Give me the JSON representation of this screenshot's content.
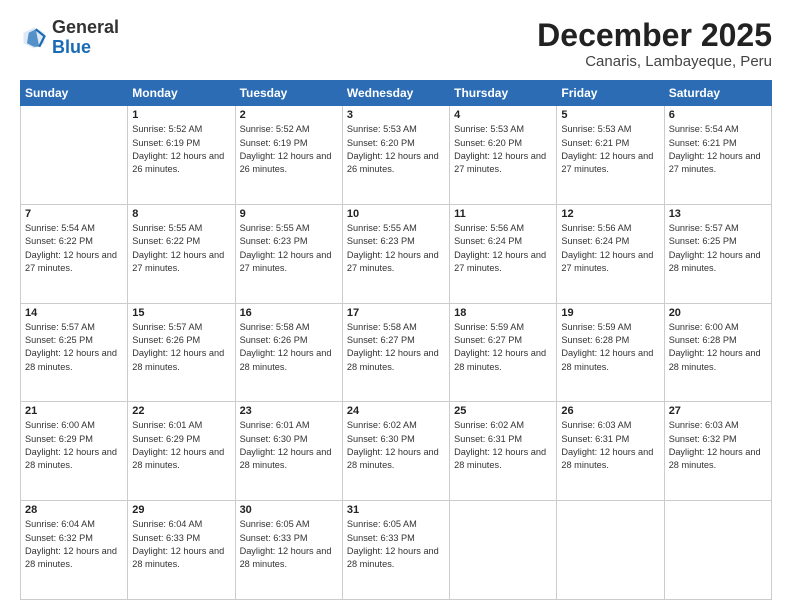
{
  "header": {
    "logo_general": "General",
    "logo_blue": "Blue",
    "month": "December 2025",
    "location": "Canaris, Lambayeque, Peru"
  },
  "days_of_week": [
    "Sunday",
    "Monday",
    "Tuesday",
    "Wednesday",
    "Thursday",
    "Friday",
    "Saturday"
  ],
  "weeks": [
    [
      {
        "day": "",
        "info": ""
      },
      {
        "day": "1",
        "info": "Sunrise: 5:52 AM\nSunset: 6:19 PM\nDaylight: 12 hours\nand 26 minutes."
      },
      {
        "day": "2",
        "info": "Sunrise: 5:52 AM\nSunset: 6:19 PM\nDaylight: 12 hours\nand 26 minutes."
      },
      {
        "day": "3",
        "info": "Sunrise: 5:53 AM\nSunset: 6:20 PM\nDaylight: 12 hours\nand 26 minutes."
      },
      {
        "day": "4",
        "info": "Sunrise: 5:53 AM\nSunset: 6:20 PM\nDaylight: 12 hours\nand 27 minutes."
      },
      {
        "day": "5",
        "info": "Sunrise: 5:53 AM\nSunset: 6:21 PM\nDaylight: 12 hours\nand 27 minutes."
      },
      {
        "day": "6",
        "info": "Sunrise: 5:54 AM\nSunset: 6:21 PM\nDaylight: 12 hours\nand 27 minutes."
      }
    ],
    [
      {
        "day": "7",
        "info": "Sunrise: 5:54 AM\nSunset: 6:22 PM\nDaylight: 12 hours\nand 27 minutes."
      },
      {
        "day": "8",
        "info": "Sunrise: 5:55 AM\nSunset: 6:22 PM\nDaylight: 12 hours\nand 27 minutes."
      },
      {
        "day": "9",
        "info": "Sunrise: 5:55 AM\nSunset: 6:23 PM\nDaylight: 12 hours\nand 27 minutes."
      },
      {
        "day": "10",
        "info": "Sunrise: 5:55 AM\nSunset: 6:23 PM\nDaylight: 12 hours\nand 27 minutes."
      },
      {
        "day": "11",
        "info": "Sunrise: 5:56 AM\nSunset: 6:24 PM\nDaylight: 12 hours\nand 27 minutes."
      },
      {
        "day": "12",
        "info": "Sunrise: 5:56 AM\nSunset: 6:24 PM\nDaylight: 12 hours\nand 27 minutes."
      },
      {
        "day": "13",
        "info": "Sunrise: 5:57 AM\nSunset: 6:25 PM\nDaylight: 12 hours\nand 28 minutes."
      }
    ],
    [
      {
        "day": "14",
        "info": "Sunrise: 5:57 AM\nSunset: 6:25 PM\nDaylight: 12 hours\nand 28 minutes."
      },
      {
        "day": "15",
        "info": "Sunrise: 5:57 AM\nSunset: 6:26 PM\nDaylight: 12 hours\nand 28 minutes."
      },
      {
        "day": "16",
        "info": "Sunrise: 5:58 AM\nSunset: 6:26 PM\nDaylight: 12 hours\nand 28 minutes."
      },
      {
        "day": "17",
        "info": "Sunrise: 5:58 AM\nSunset: 6:27 PM\nDaylight: 12 hours\nand 28 minutes."
      },
      {
        "day": "18",
        "info": "Sunrise: 5:59 AM\nSunset: 6:27 PM\nDaylight: 12 hours\nand 28 minutes."
      },
      {
        "day": "19",
        "info": "Sunrise: 5:59 AM\nSunset: 6:28 PM\nDaylight: 12 hours\nand 28 minutes."
      },
      {
        "day": "20",
        "info": "Sunrise: 6:00 AM\nSunset: 6:28 PM\nDaylight: 12 hours\nand 28 minutes."
      }
    ],
    [
      {
        "day": "21",
        "info": "Sunrise: 6:00 AM\nSunset: 6:29 PM\nDaylight: 12 hours\nand 28 minutes."
      },
      {
        "day": "22",
        "info": "Sunrise: 6:01 AM\nSunset: 6:29 PM\nDaylight: 12 hours\nand 28 minutes."
      },
      {
        "day": "23",
        "info": "Sunrise: 6:01 AM\nSunset: 6:30 PM\nDaylight: 12 hours\nand 28 minutes."
      },
      {
        "day": "24",
        "info": "Sunrise: 6:02 AM\nSunset: 6:30 PM\nDaylight: 12 hours\nand 28 minutes."
      },
      {
        "day": "25",
        "info": "Sunrise: 6:02 AM\nSunset: 6:31 PM\nDaylight: 12 hours\nand 28 minutes."
      },
      {
        "day": "26",
        "info": "Sunrise: 6:03 AM\nSunset: 6:31 PM\nDaylight: 12 hours\nand 28 minutes."
      },
      {
        "day": "27",
        "info": "Sunrise: 6:03 AM\nSunset: 6:32 PM\nDaylight: 12 hours\nand 28 minutes."
      }
    ],
    [
      {
        "day": "28",
        "info": "Sunrise: 6:04 AM\nSunset: 6:32 PM\nDaylight: 12 hours\nand 28 minutes."
      },
      {
        "day": "29",
        "info": "Sunrise: 6:04 AM\nSunset: 6:33 PM\nDaylight: 12 hours\nand 28 minutes."
      },
      {
        "day": "30",
        "info": "Sunrise: 6:05 AM\nSunset: 6:33 PM\nDaylight: 12 hours\nand 28 minutes."
      },
      {
        "day": "31",
        "info": "Sunrise: 6:05 AM\nSunset: 6:33 PM\nDaylight: 12 hours\nand 28 minutes."
      },
      {
        "day": "",
        "info": ""
      },
      {
        "day": "",
        "info": ""
      },
      {
        "day": "",
        "info": ""
      }
    ]
  ]
}
